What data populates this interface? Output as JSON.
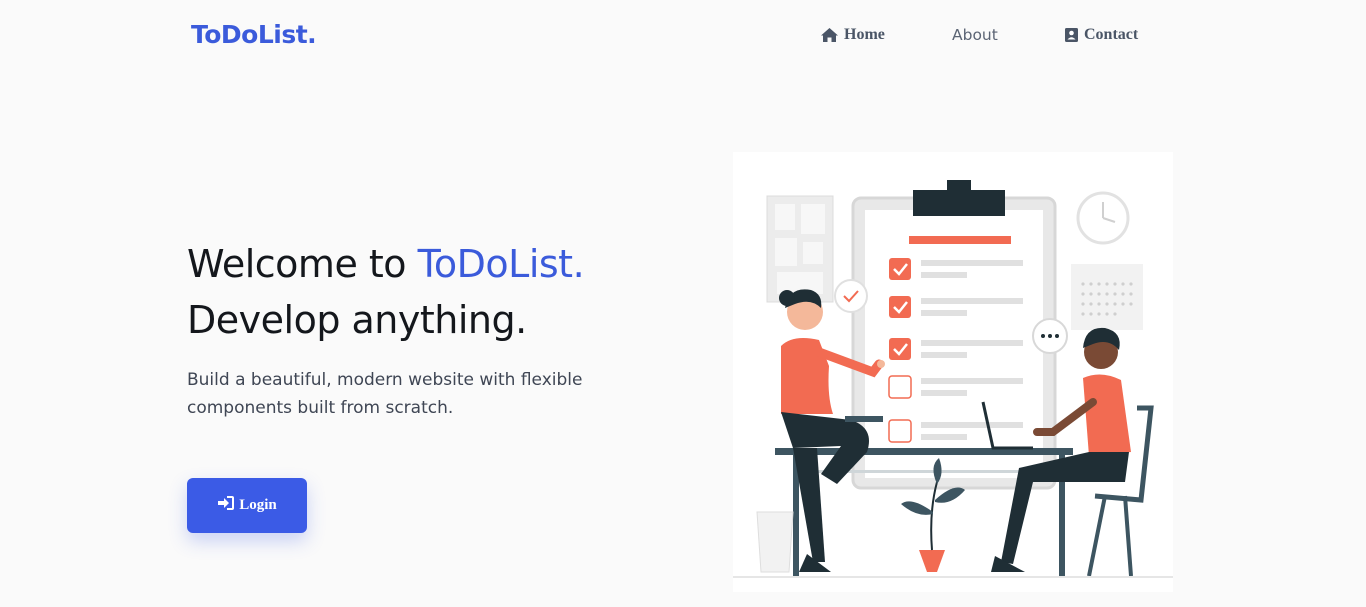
{
  "brand": "ToDoList.",
  "nav": {
    "home": "Home",
    "about": "About",
    "contact": "Contact"
  },
  "hero": {
    "title_prefix": "Welcome to ",
    "title_accent": "ToDoList.",
    "title_line2": "Develop anything.",
    "subtitle": "Build a beautiful, modern website with flexible components built from scratch."
  },
  "login_label": "Login",
  "icons": {
    "home": "home-icon",
    "contact": "contact-card-icon",
    "login": "sign-in-icon"
  },
  "colors": {
    "accent": "#3b5bdb",
    "button": "#3b5be6",
    "illustration_coral": "#f26b52",
    "illustration_dark": "#1f2e35"
  }
}
